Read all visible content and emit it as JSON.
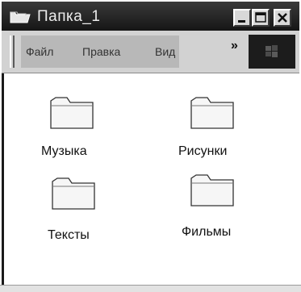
{
  "window": {
    "title": "Папка_1"
  },
  "title_buttons": {
    "minimize_icon": "minimize-icon",
    "maximize_icon": "maximize-icon",
    "close_icon": "close-icon"
  },
  "menu": {
    "items": [
      {
        "label": "Файл"
      },
      {
        "label": "Правка"
      },
      {
        "label": "Вид"
      }
    ],
    "more_label": "»"
  },
  "folders": [
    {
      "label": "Музыка",
      "icon": "folder-icon"
    },
    {
      "label": "Рисунки",
      "icon": "folder-icon"
    },
    {
      "label": "Тексты",
      "icon": "folder-icon"
    },
    {
      "label": "Фильмы",
      "icon": "folder-icon"
    }
  ]
}
